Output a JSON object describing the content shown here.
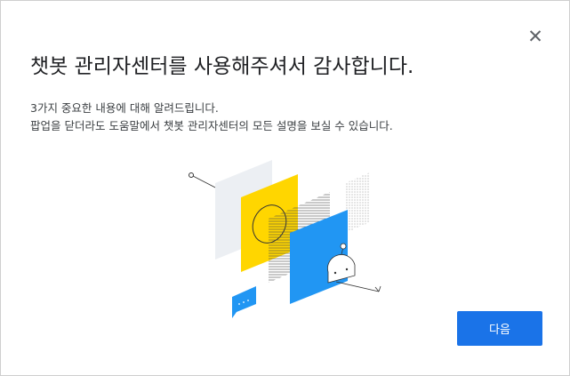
{
  "dialog": {
    "title": "챗봇 관리자센터를 사용해주셔서 감사합니다.",
    "description_line1": "3가지 중요한 내용에 대해 알려드립니다.",
    "description_line2": "팝업을 닫더라도 도움말에서 챗봇 관리자센터의 모든 설명을 보실 수 있습니다.",
    "close_icon": "close-icon",
    "next_label": "다음"
  },
  "colors": {
    "accent": "#1a73e8",
    "illustration_yellow": "#ffd600",
    "illustration_blue": "#2196f3",
    "illustration_gray": "#eceff3"
  }
}
